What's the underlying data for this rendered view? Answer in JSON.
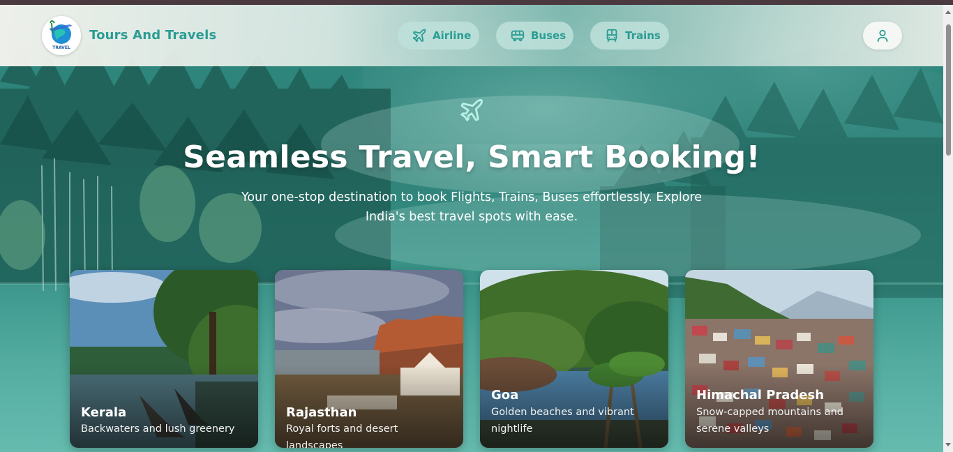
{
  "header": {
    "brand": "Tours And Travels",
    "logo_text": "TRAVEL",
    "nav": [
      {
        "label": "Airline",
        "icon": "airplane-icon"
      },
      {
        "label": "Buses",
        "icon": "bus-icon"
      },
      {
        "label": "Trains",
        "icon": "train-icon"
      }
    ],
    "account_icon": "user-icon"
  },
  "hero": {
    "icon": "airplane-icon",
    "title": "Seamless Travel, Smart Booking!",
    "subtitle": "Your one-stop destination to book Flights, Trains, Buses effortlessly. Explore India's best travel spots with ease."
  },
  "destinations": [
    {
      "title": "Kerala",
      "description": "Backwaters and lush greenery"
    },
    {
      "title": "Rajasthan",
      "description": "Royal forts and desert landscapes"
    },
    {
      "title": "Goa",
      "description": "Golden beaches and vibrant nightlife"
    },
    {
      "title": "Himachal Pradesh",
      "description": "Snow-capped mountains and serene valleys"
    }
  ],
  "colors": {
    "accent": "#2a9d93",
    "hero_bg": "#2f8a80",
    "text_light": "#ffffff"
  }
}
